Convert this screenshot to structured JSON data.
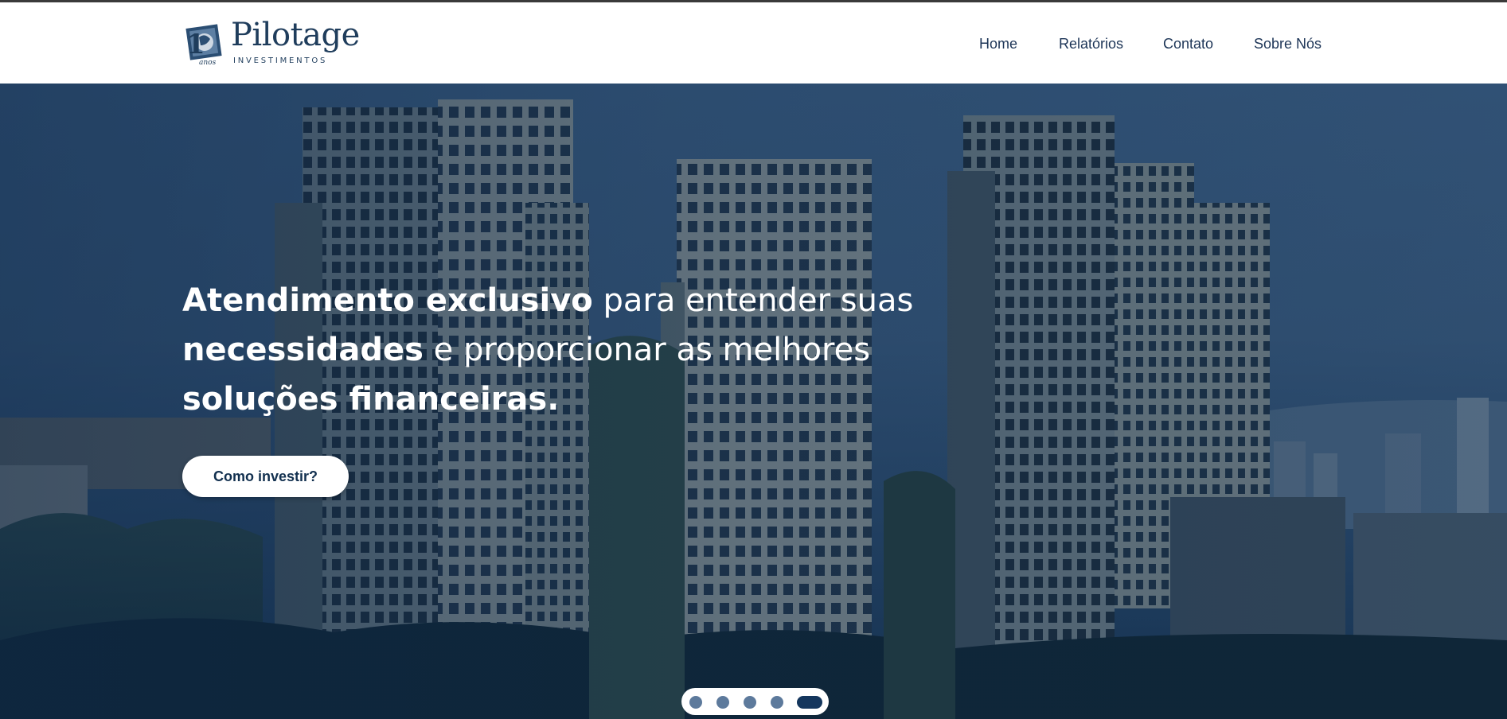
{
  "brand": {
    "name": "Pilotage",
    "subtitle": "INVESTIMENTOS",
    "badge_number": "10",
    "badge_word": "anos",
    "color": "#1f3d5c"
  },
  "nav": {
    "items": [
      {
        "label": "Home"
      },
      {
        "label": "Relatórios"
      },
      {
        "label": "Contato"
      },
      {
        "label": "Sobre Nós"
      }
    ]
  },
  "hero": {
    "line1_bold": "Atendimento exclusivo",
    "line1_rest": " para entender suas",
    "line2_bold": "necessidades",
    "line2_rest": " e proporcionar as melhores",
    "line3_bold": "soluções financeiras.",
    "cta_label": "Como investir?"
  },
  "carousel": {
    "slide_count": 5,
    "active_index": 4
  },
  "colors": {
    "accent": "#14365d",
    "text_on_hero": "#ffffff"
  }
}
